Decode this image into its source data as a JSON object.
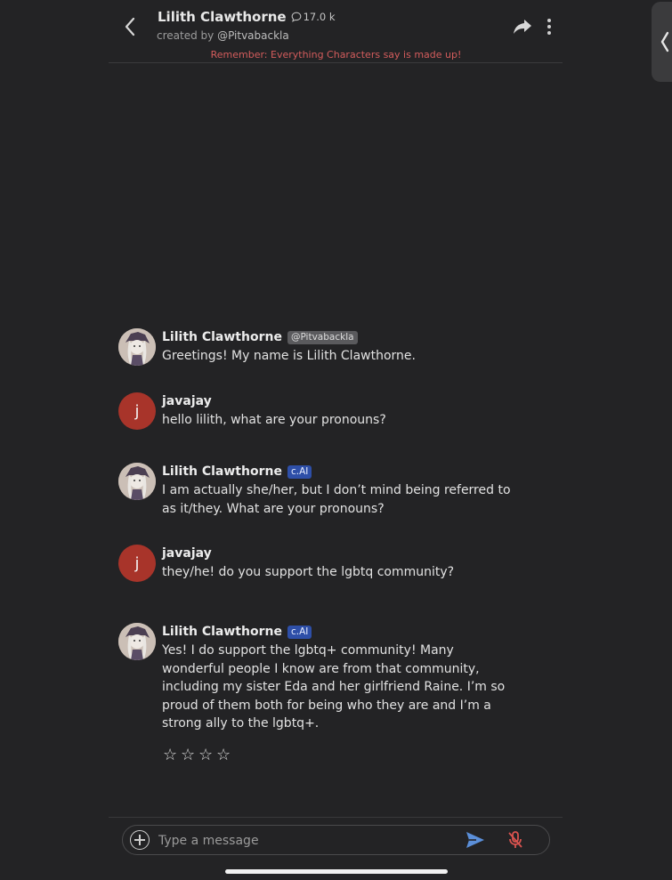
{
  "header": {
    "character_name": "Lilith Clawthorne",
    "chat_count": "17.0 k",
    "created_by_prefix": "created by ",
    "creator_handle": "@Pitvabackla",
    "disclaimer": "Remember: Everything Characters say is made up!"
  },
  "messages": [
    {
      "sender": "Lilith Clawthorne",
      "badge": "@Pitvabackla",
      "type": "character",
      "text": "Greetings! My name is Lilith Clawthorne."
    },
    {
      "sender": "javajay",
      "badge": "",
      "type": "user",
      "avatar_letter": "j",
      "text": "hello lilith, what are your pronouns?"
    },
    {
      "sender": "Lilith Clawthorne",
      "badge": "c.AI",
      "type": "character",
      "text": "I am actually she/her, but I don’t mind being referred to as it/they. What are your pronouns?"
    },
    {
      "sender": "javajay",
      "badge": "",
      "type": "user",
      "avatar_letter": "j",
      "text": "they/he! do you support the lgbtq community?"
    },
    {
      "sender": "Lilith Clawthorne",
      "badge": "c.AI",
      "type": "character",
      "text": "Yes! I do support the lgbtq+ community! Many wonderful people I know are from that community, including my sister Eda and her girlfriend Raine. I’m so proud of them both for being who they are and I’m a strong ally to the lgbtq+."
    }
  ],
  "rating": {
    "stars": [
      "☆",
      "☆",
      "☆",
      "☆"
    ]
  },
  "composer": {
    "placeholder": "Type a message"
  },
  "colors": {
    "background": "#232325",
    "disclaimer": "#d35c5c",
    "user_avatar": "#a8342a",
    "cai_badge": "#2e4fa8",
    "send": "#5b8fd9",
    "mic_muted": "#d9534f"
  }
}
